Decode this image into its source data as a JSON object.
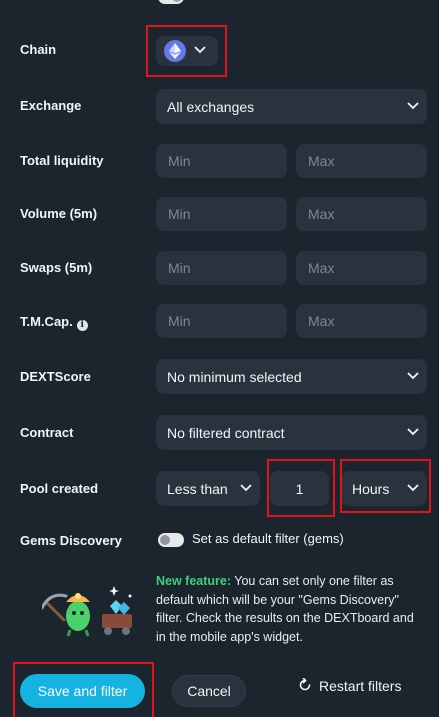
{
  "chain": {
    "label": "Chain",
    "selected_icon": "ethereum-icon"
  },
  "exchange": {
    "label": "Exchange",
    "value": "All exchanges"
  },
  "total_liquidity": {
    "label": "Total liquidity",
    "min_placeholder": "Min",
    "max_placeholder": "Max"
  },
  "volume": {
    "label": "Volume (5m)",
    "min_placeholder": "Min",
    "max_placeholder": "Max"
  },
  "swaps": {
    "label": "Swaps (5m)",
    "min_placeholder": "Min",
    "max_placeholder": "Max"
  },
  "tmcap": {
    "label": "T.M.Cap.",
    "info_glyph": "i",
    "min_placeholder": "Min",
    "max_placeholder": "Max"
  },
  "dextscore": {
    "label": "DEXTScore",
    "value": "No minimum selected"
  },
  "contract": {
    "label": "Contract",
    "value": "No filtered contract"
  },
  "pool_created": {
    "label": "Pool created",
    "comparator": "Less than",
    "amount": "1",
    "unit": "Hours"
  },
  "gems": {
    "label": "Gems Discovery",
    "toggle_label": "Set as default filter (gems)"
  },
  "promo": {
    "highlight": "New feature:",
    "text": " You can set only one filter as default which will be your \"Gems Discovery\" filter. Check the results on the DEXTboard and in the mobile app's widget."
  },
  "actions": {
    "save": "Save and filter",
    "cancel": "Cancel",
    "restart": "Restart filters"
  },
  "colors": {
    "accent": "#14b3e2",
    "highlight": "#3fd07a",
    "annotation": "#e0141b",
    "background": "#1c242d"
  }
}
